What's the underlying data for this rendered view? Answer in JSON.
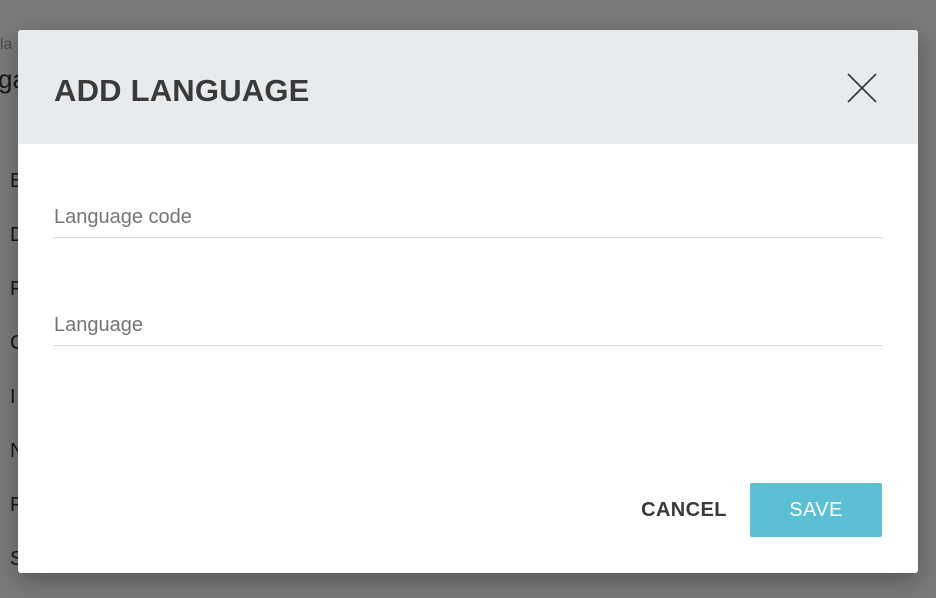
{
  "background": {
    "small_label": "la",
    "big_label": "ga",
    "list_items": [
      "E",
      "D",
      "F",
      "C",
      "I",
      "N",
      "F",
      "S"
    ]
  },
  "dialog": {
    "title": "ADD LANGUAGE",
    "close_icon": "close-icon",
    "fields": {
      "language_code": {
        "value": "",
        "placeholder": "Language code"
      },
      "language": {
        "value": "",
        "placeholder": "Language"
      }
    },
    "buttons": {
      "cancel_label": "CANCEL",
      "save_label": "SAVE"
    }
  },
  "colors": {
    "header_bg": "#e8ebee",
    "save_button_bg": "#5bc0d3",
    "overlay": "rgba(0,0,0,0.52)"
  }
}
